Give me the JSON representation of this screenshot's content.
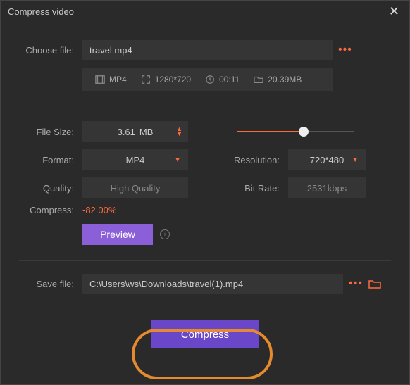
{
  "window_title": "Compress video",
  "choose_file": {
    "label": "Choose file:",
    "value": "travel.mp4"
  },
  "file_info": {
    "format": "MP4",
    "resolution": "1280*720",
    "duration": "00:11",
    "size": "20.39MB"
  },
  "settings": {
    "file_size": {
      "label": "File Size:",
      "value": "3.61",
      "unit": "MB"
    },
    "format": {
      "label": "Format:",
      "value": "MP4"
    },
    "quality": {
      "label": "Quality:",
      "value": "High Quality"
    },
    "resolution": {
      "label": "Resolution:",
      "value": "720*480"
    },
    "bitrate": {
      "label": "Bit Rate:",
      "value": "2531kbps"
    }
  },
  "compress": {
    "label": "Compress:",
    "value": "-82.00%"
  },
  "preview_label": "Preview",
  "save_file": {
    "label": "Save file:",
    "value": "C:\\Users\\ws\\Downloads\\travel(1).mp4"
  },
  "compress_button": "Compress"
}
